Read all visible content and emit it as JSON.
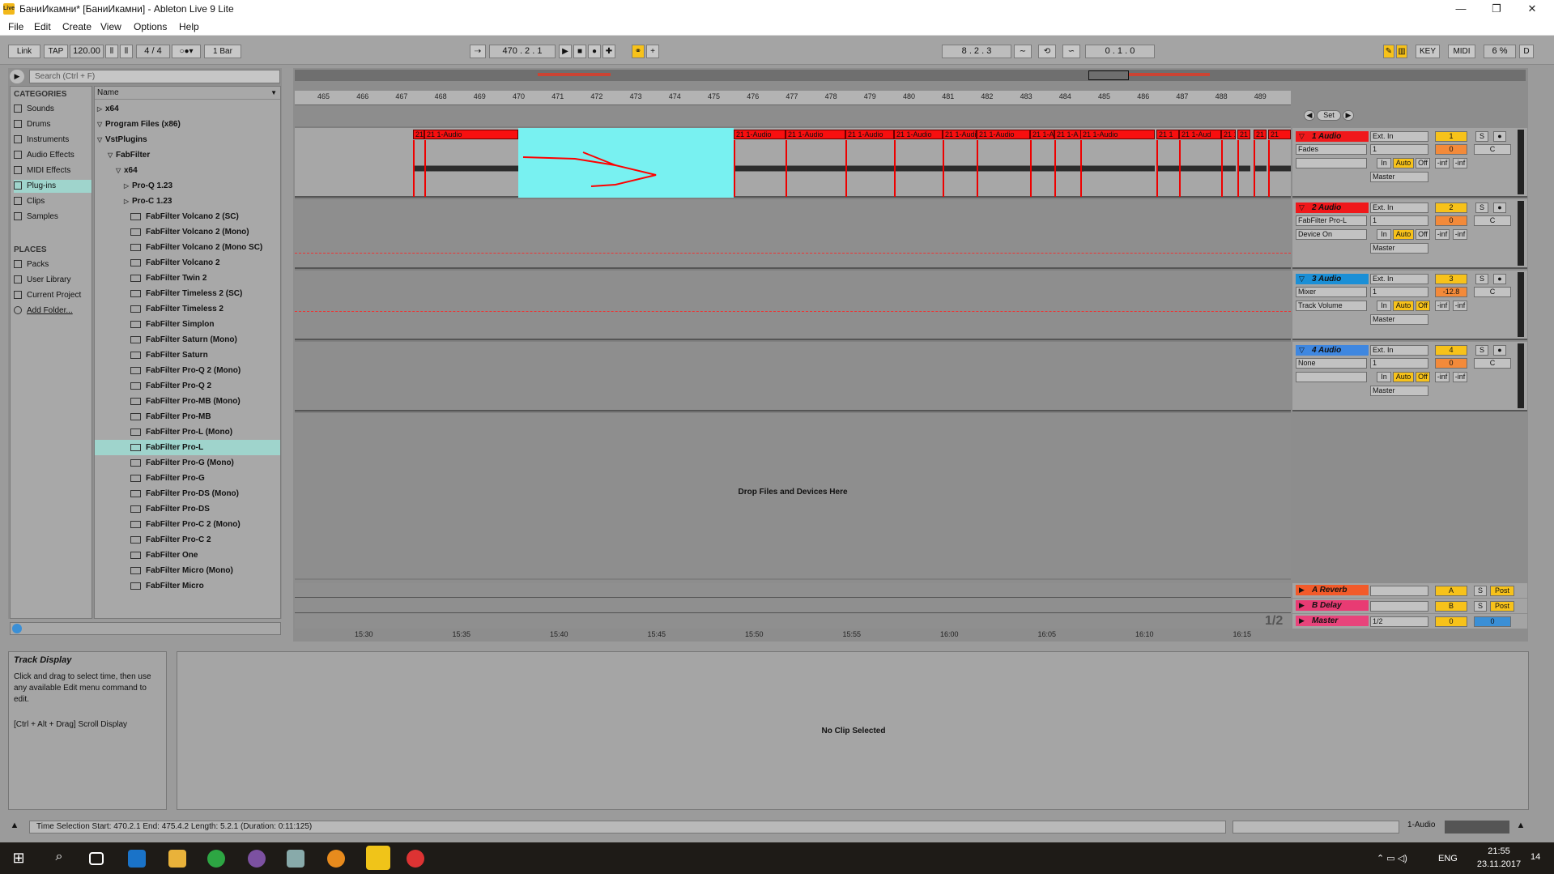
{
  "window": {
    "title": "БаниИкамни*  [БаниИкамни] - Ableton Live 9 Lite",
    "logo_text": "Live",
    "minimize": "—",
    "maximize": "❐",
    "close": "✕"
  },
  "menu": [
    "File",
    "Edit",
    "Create",
    "View",
    "Options",
    "Help"
  ],
  "control_bar": {
    "link": "Link",
    "tap": "TAP",
    "tempo": "120.00",
    "time_sig": "4 / 4",
    "quantize": "1 Bar",
    "arrangement_position": "470 .  2 .  1",
    "loop_start": "8 .  2 .  3",
    "loop_length": "0 .  1 .  0",
    "key": "KEY",
    "midi": "MIDI",
    "cpu": "6 %",
    "d": "D"
  },
  "browser": {
    "search_placeholder": "Search (Ctrl + F)",
    "categories_header": "CATEGORIES",
    "categories": [
      "Sounds",
      "Drums",
      "Instruments",
      "Audio Effects",
      "MIDI Effects",
      "Plug-ins",
      "Clips",
      "Samples"
    ],
    "places_header": "PLACES",
    "places": [
      "Packs",
      "User Library",
      "Current Project",
      "Add Folder..."
    ],
    "name_header": "Name",
    "tree": [
      {
        "label": "x64",
        "indent": 0,
        "kind": "folder-closed"
      },
      {
        "label": "Program Files (x86)",
        "indent": 0,
        "kind": "folder-open"
      },
      {
        "label": "VstPlugins",
        "indent": 1,
        "kind": "folder-open"
      },
      {
        "label": "FabFilter",
        "indent": 2,
        "kind": "folder-open"
      },
      {
        "label": "x64",
        "indent": 3,
        "kind": "folder-open"
      },
      {
        "label": "Pro-Q 1.23",
        "indent": 4,
        "kind": "folder-closed"
      },
      {
        "label": "Pro-C 1.23",
        "indent": 4,
        "kind": "folder-closed"
      },
      {
        "label": "FabFilter Volcano 2 (SC)",
        "indent": 5,
        "kind": "plugin"
      },
      {
        "label": "FabFilter Volcano 2 (Mono)",
        "indent": 5,
        "kind": "plugin"
      },
      {
        "label": "FabFilter Volcano 2 (Mono SC)",
        "indent": 5,
        "kind": "plugin"
      },
      {
        "label": "FabFilter Volcano 2",
        "indent": 5,
        "kind": "plugin"
      },
      {
        "label": "FabFilter Twin 2",
        "indent": 5,
        "kind": "plugin"
      },
      {
        "label": "FabFilter Timeless 2 (SC)",
        "indent": 5,
        "kind": "plugin"
      },
      {
        "label": "FabFilter Timeless 2",
        "indent": 5,
        "kind": "plugin"
      },
      {
        "label": "FabFilter Simplon",
        "indent": 5,
        "kind": "plugin"
      },
      {
        "label": "FabFilter Saturn (Mono)",
        "indent": 5,
        "kind": "plugin"
      },
      {
        "label": "FabFilter Saturn",
        "indent": 5,
        "kind": "plugin"
      },
      {
        "label": "FabFilter Pro-Q 2 (Mono)",
        "indent": 5,
        "kind": "plugin"
      },
      {
        "label": "FabFilter Pro-Q 2",
        "indent": 5,
        "kind": "plugin"
      },
      {
        "label": "FabFilter Pro-MB (Mono)",
        "indent": 5,
        "kind": "plugin"
      },
      {
        "label": "FabFilter Pro-MB",
        "indent": 5,
        "kind": "plugin"
      },
      {
        "label": "FabFilter Pro-L (Mono)",
        "indent": 5,
        "kind": "plugin"
      },
      {
        "label": "FabFilter Pro-L",
        "indent": 5,
        "kind": "plugin",
        "selected": true
      },
      {
        "label": "FabFilter Pro-G (Mono)",
        "indent": 5,
        "kind": "plugin"
      },
      {
        "label": "FabFilter Pro-G",
        "indent": 5,
        "kind": "plugin"
      },
      {
        "label": "FabFilter Pro-DS (Mono)",
        "indent": 5,
        "kind": "plugin"
      },
      {
        "label": "FabFilter Pro-DS",
        "indent": 5,
        "kind": "plugin"
      },
      {
        "label": "FabFilter Pro-C 2 (Mono)",
        "indent": 5,
        "kind": "plugin"
      },
      {
        "label": "FabFilter Pro-C 2",
        "indent": 5,
        "kind": "plugin"
      },
      {
        "label": "FabFilter One",
        "indent": 5,
        "kind": "plugin"
      },
      {
        "label": "FabFilter Micro (Mono)",
        "indent": 5,
        "kind": "plugin"
      },
      {
        "label": "FabFilter Micro",
        "indent": 5,
        "kind": "plugin"
      }
    ]
  },
  "arrangement": {
    "ruler_bars": [
      "465",
      "466",
      "467",
      "468",
      "469",
      "470",
      "471",
      "472",
      "473",
      "474",
      "475",
      "476",
      "477",
      "478",
      "479",
      "480",
      "481",
      "482",
      "483",
      "484",
      "485",
      "486",
      "487",
      "488",
      "489"
    ],
    "clip_labels": [
      "21",
      "21 1-Audio",
      "21 1-Audio",
      "21 1-Audio",
      "21 1-Audio",
      "21 1-Audio",
      "21 1-Audio",
      "21 1-Audio",
      "21 1-A",
      "21 1-A",
      "21 1-Audio",
      "21 1",
      "21 1-Aud",
      "21 1",
      "21 1",
      "21 1",
      "21"
    ],
    "drop_text": "Drop Files and Devices Here",
    "time_ticks": [
      "15:30",
      "15:35",
      "15:40",
      "15:45",
      "15:50",
      "15:55",
      "16:00",
      "16:05",
      "16:10",
      "16:15"
    ],
    "page_indicator": "1/2",
    "set_label": "Set"
  },
  "tracks": [
    {
      "name": "1 Audio",
      "color": "#f0181b",
      "device": "Fades",
      "input": "Ext. In",
      "channel": "1",
      "output": "Master",
      "number": "1",
      "volume": "0",
      "pan": "C",
      "in": "In",
      "auto": "Auto",
      "off": "Off",
      "inf1": "-inf",
      "inf2": "-inf"
    },
    {
      "name": "2 Audio",
      "color": "#f0181b",
      "device": "FabFilter Pro-L",
      "device2": "Device On",
      "input": "Ext. In",
      "channel": "1",
      "output": "Master",
      "number": "2",
      "volume": "0",
      "pan": "C",
      "in": "In",
      "auto": "Auto",
      "off": "Off",
      "inf1": "-inf",
      "inf2": "-inf"
    },
    {
      "name": "3 Audio",
      "color": "#1b8fd6",
      "device": "Mixer",
      "device2": "Track Volume",
      "input": "Ext. In",
      "channel": "1",
      "output": "Master",
      "number": "3",
      "volume": "-12.8",
      "pan": "C",
      "in": "In",
      "auto": "Auto",
      "off": "Off",
      "inf1": "-inf",
      "inf2": "-inf"
    },
    {
      "name": "4 Audio",
      "color": "#3f87e0",
      "device": "None",
      "input": "Ext. In",
      "channel": "1",
      "output": "Master",
      "number": "4",
      "volume": "0",
      "pan": "C",
      "in": "In",
      "auto": "Auto",
      "off": "Off",
      "inf1": "-inf",
      "inf2": "-inf"
    }
  ],
  "returns": [
    {
      "name": "A Reverb",
      "color": "#f25a2a",
      "letter": "A",
      "s": "S",
      "post": "Post"
    },
    {
      "name": "B Delay",
      "color": "#e83b73",
      "letter": "B",
      "s": "S",
      "post": "Post"
    },
    {
      "name": "Master",
      "color": "#e8447b",
      "letter": "0",
      "out": "1/2",
      "vol": "0"
    }
  ],
  "info": {
    "title": "Track Display",
    "body": "Click and drag to select time, then use any available Edit menu command to edit.",
    "shortcut": "[Ctrl + Alt + Drag] Scroll Display"
  },
  "detail": {
    "text": "No Clip Selected"
  },
  "status": {
    "text": "Time Selection   Start: 470.2.1   End: 475.4.2   Length: 5.2.1  (Duration: 0:11:125)",
    "right": "1-Audio"
  },
  "taskbar": {
    "lang": "ENG",
    "time": "21:55",
    "date": "23.11.2017",
    "notif": "14"
  }
}
